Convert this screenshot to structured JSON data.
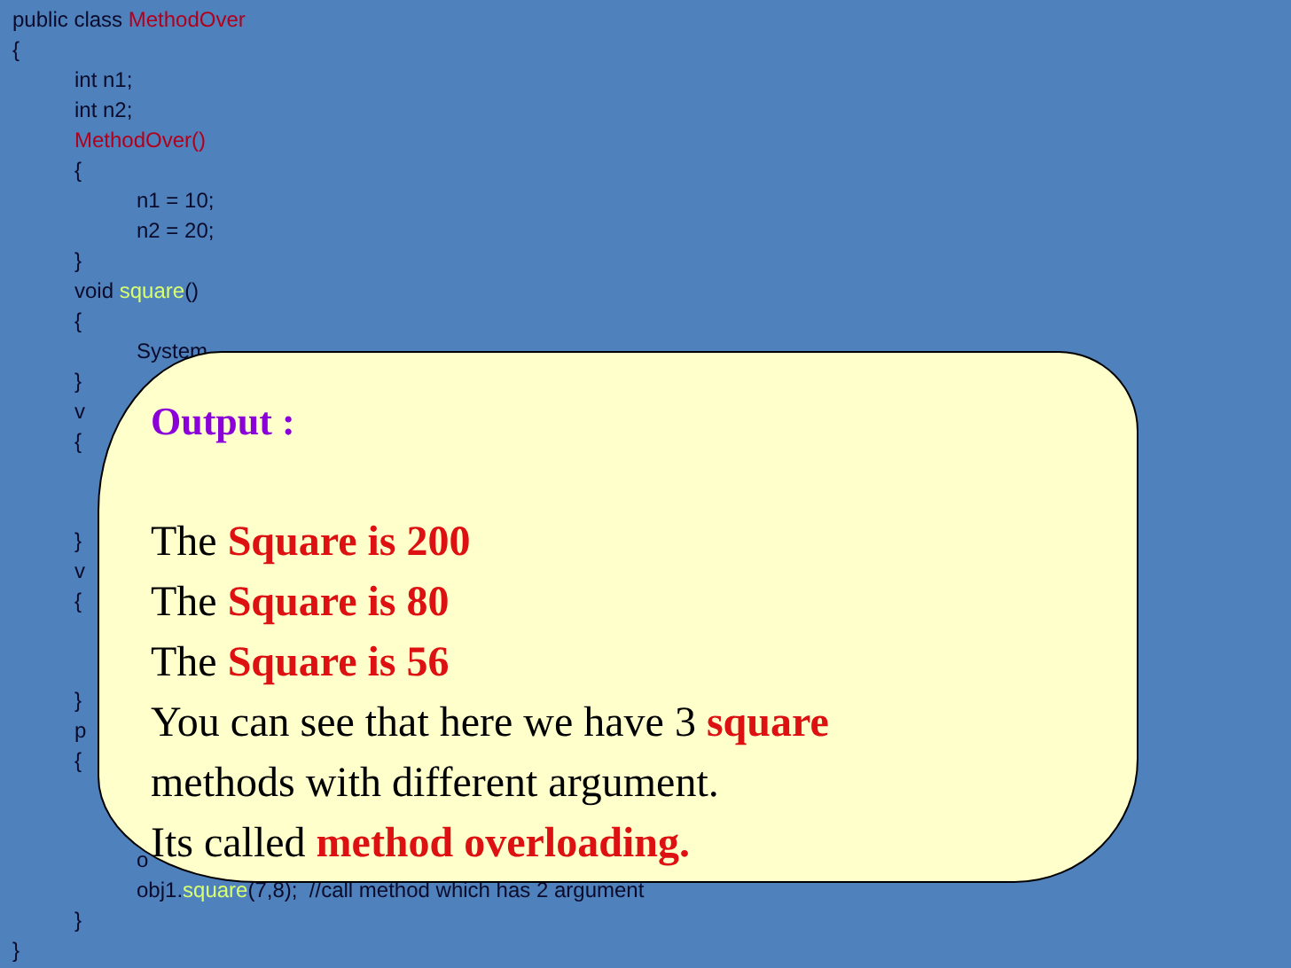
{
  "code_blocks": [
    [
      {
        "segments": [
          {
            "text": "public class ",
            "kind": "plain"
          },
          {
            "text": "MethodOver",
            "kind": "name"
          }
        ]
      },
      {
        "segments": [
          {
            "text": "{",
            "kind": "plain"
          }
        ]
      },
      {
        "segments": [
          {
            "text": "\tint n1;",
            "kind": "plain"
          }
        ]
      },
      {
        "segments": [
          {
            "text": "\tint n2;",
            "kind": "plain"
          }
        ]
      },
      {
        "segments": [
          {
            "text": "\tMethodOver()",
            "kind": "name"
          }
        ]
      },
      {
        "segments": [
          {
            "text": "\t{",
            "kind": "plain"
          }
        ]
      },
      {
        "segments": [
          {
            "text": "\t\tn1 = 10;",
            "kind": "plain"
          }
        ]
      },
      {
        "segments": [
          {
            "text": "\t\tn2 = 20;",
            "kind": "plain"
          }
        ]
      },
      {
        "segments": [
          {
            "text": "\t}",
            "kind": "plain"
          }
        ]
      },
      {
        "segments": [
          {
            "text": "\tvoid ",
            "kind": "plain"
          },
          {
            "text": "square",
            "kind": "method"
          },
          {
            "text": "()",
            "kind": "plain"
          }
        ]
      },
      {
        "segments": [
          {
            "text": "\t{",
            "kind": "plain"
          }
        ]
      },
      {
        "segments": [
          {
            "text": "\t\tSystem",
            "kind": "plain"
          }
        ]
      },
      {
        "segments": [
          {
            "text": "\t}",
            "kind": "plain"
          }
        ]
      },
      {
        "segments": [
          {
            "text": "\tv",
            "kind": "plain"
          }
        ]
      },
      {
        "segments": [
          {
            "text": "\t{",
            "kind": "plain"
          }
        ]
      }
    ],
    [
      {
        "segments": [
          {
            "text": "\t}",
            "kind": "plain"
          }
        ]
      },
      {
        "segments": [
          {
            "text": "\tv",
            "kind": "plain"
          }
        ]
      },
      {
        "segments": [
          {
            "text": "\t{",
            "kind": "plain"
          }
        ]
      }
    ],
    [
      {
        "segments": [
          {
            "text": "\t}",
            "kind": "plain"
          }
        ]
      },
      {
        "segments": [
          {
            "text": "\tp",
            "kind": "plain"
          }
        ]
      },
      {
        "segments": [
          {
            "text": "\t{",
            "kind": "plain"
          }
        ]
      }
    ],
    [
      {
        "segments": [
          {
            "text": "\t\to",
            "kind": "plain"
          }
        ]
      },
      {
        "segments": [
          {
            "text": "\t\tobj1.",
            "kind": "plain"
          },
          {
            "text": "square",
            "kind": "method"
          },
          {
            "text": "(7,8);  //call method which has 2 argument",
            "kind": "plain"
          }
        ]
      },
      {
        "segments": [
          {
            "text": "\t}",
            "kind": "plain"
          }
        ]
      },
      {
        "segments": [
          {
            "text": "}",
            "kind": "plain"
          }
        ]
      }
    ]
  ],
  "output_callout": {
    "heading": "Output :",
    "lines": [
      "The **Square is 200**",
      "The **Square is 80**",
      "The **Square is 56**",
      "You can see that here we have 3 **square**",
      "methods with different argument.",
      "Its called **method overloading.**"
    ]
  }
}
